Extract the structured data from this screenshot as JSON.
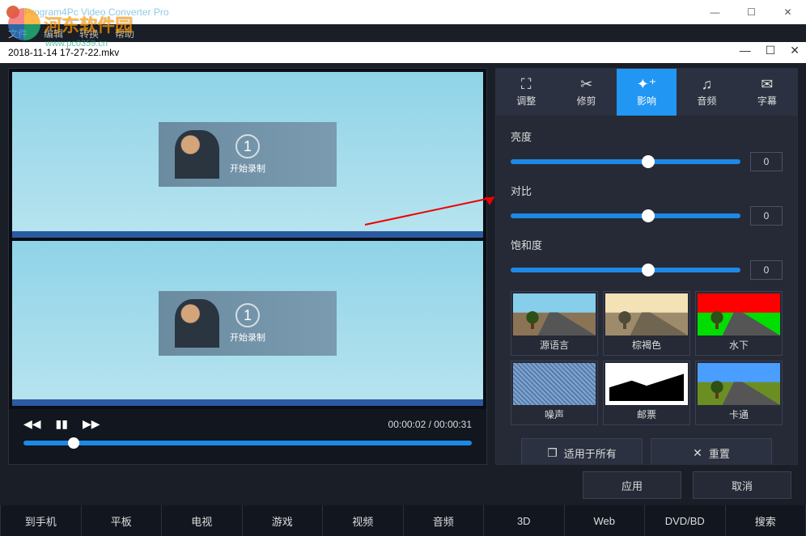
{
  "window": {
    "title": "Program4Pc Video Converter Pro"
  },
  "menu": {
    "file": "文件",
    "edit": "编辑",
    "convert": "转换",
    "help": "帮助"
  },
  "watermark": {
    "text": "河东软件园",
    "url": "www.pc0359.cn"
  },
  "filebar": {
    "filename": "2018-11-14 17-27-22.mkv"
  },
  "preview": {
    "badge_num": "1",
    "badge_text": "开始录制"
  },
  "playback": {
    "current": "00:00:02",
    "sep": "/",
    "total": "00:00:31"
  },
  "tabs": {
    "crop": "调整",
    "trim": "修剪",
    "effect": "影响",
    "audio": "音频",
    "subtitle": "字幕"
  },
  "sliders": {
    "brightness": {
      "label": "亮度",
      "value": "0"
    },
    "contrast": {
      "label": "对比",
      "value": "0"
    },
    "saturation": {
      "label": "饱和度",
      "value": "0"
    }
  },
  "presets": {
    "original": "源语言",
    "sepia": "棕褐色",
    "underwater": "水下",
    "noise": "噪声",
    "stamp": "邮票",
    "cartoon": "卡通"
  },
  "actions": {
    "apply_all": "适用于所有",
    "reset": "重置",
    "apply": "应用",
    "cancel": "取消"
  },
  "categories": {
    "phone": "到手机",
    "tablet": "平板",
    "tv": "电视",
    "game": "游戏",
    "video": "视频",
    "audio": "音频",
    "3d": "3D",
    "web": "Web",
    "dvd": "DVD/BD",
    "search": "搜索"
  }
}
